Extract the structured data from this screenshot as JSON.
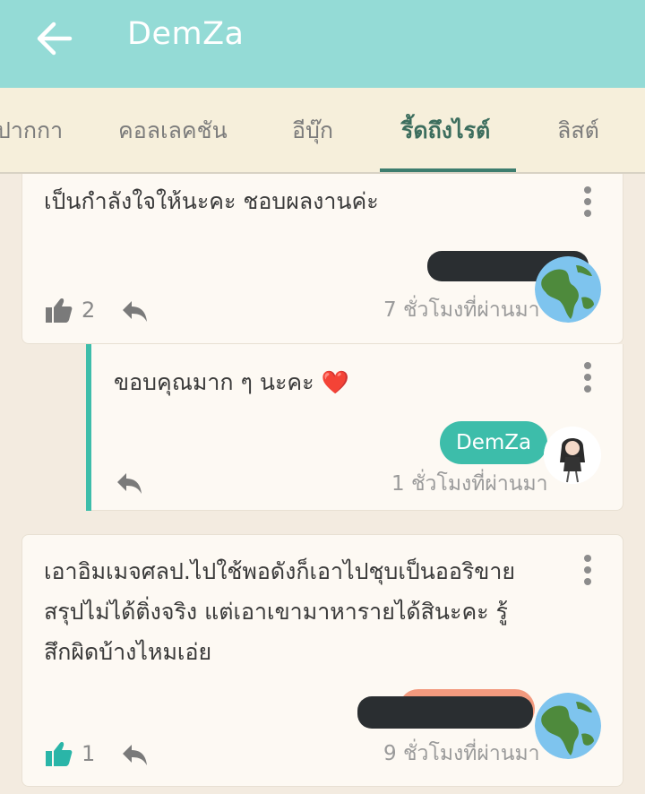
{
  "header": {
    "title": "DemZa",
    "back_label": "back"
  },
  "tabs": [
    {
      "label": "ปากกา"
    },
    {
      "label": "คอลเลคชัน"
    },
    {
      "label": "อีบุ๊ก"
    },
    {
      "label": "รี้ดถึงไรต์"
    },
    {
      "label": "ลิสต์"
    }
  ],
  "active_tab_index": 3,
  "comments": [
    {
      "text": "เป็นกำลังใจให้นะคะ ชอบผลงานค่ะ",
      "likes": "2",
      "time": "7 ชั่วโมงที่ผ่านมา"
    },
    {
      "text": "ขอบคุณมาก ๆ นะคะ ❤️",
      "author": "DemZa",
      "time": "1 ชั่วโมงที่ผ่านมา"
    },
    {
      "text_lines": [
        "เอาอิมเมจศลป.ไปใช้พอดังก็เอาไปชุบเป็นออริขาย",
        "สรุปไม่ได้ติ่งจริง แต่เอาเขามาหารายได้สินะคะ รู้",
        "สึกผิดบ้างไหมเอ่ย"
      ],
      "likes": "1",
      "time": "9 ชั่วโมงที่ผ่านมา"
    }
  ],
  "colors": {
    "header": "#94dbd6",
    "tabs_bg": "#f6efdb",
    "accent": "#3dbdaa",
    "active_tab": "#3d6e5e",
    "like_active": "#2ab5a8"
  }
}
